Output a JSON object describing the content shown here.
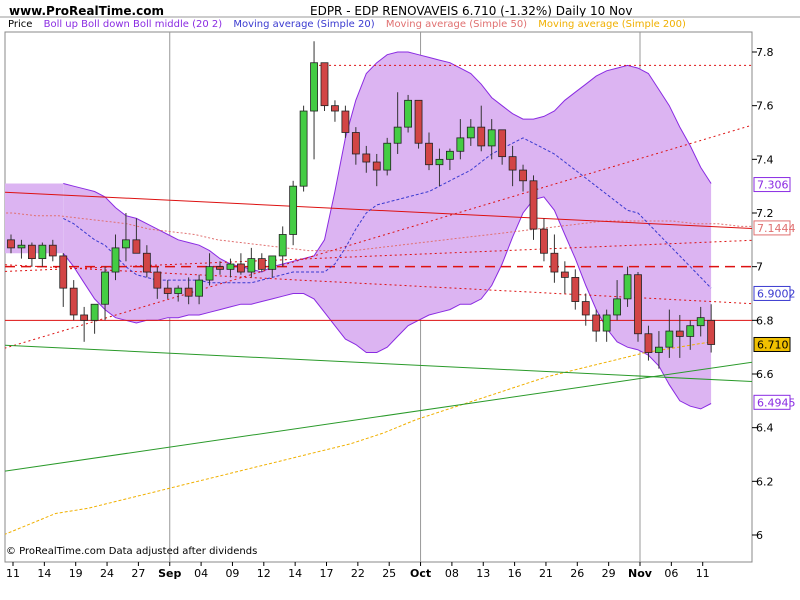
{
  "header": {
    "site": "www.ProRealTime.com",
    "title": "EDPR - EDP RENOVAVEIS    6.710 (-1.32%)    Daily  10 Nov"
  },
  "legend": [
    {
      "label": "Price",
      "color": "#000000"
    },
    {
      "label": "Boll up Boll down Boll middle (20 2)",
      "color": "#8a2be2"
    },
    {
      "label": "Moving average (Simple 20)",
      "color": "#3a3ad0"
    },
    {
      "label": "Moving average (Simple 50)",
      "color": "#e07070"
    },
    {
      "label": "Moving average (Simple 200)",
      "color": "#f0b000"
    }
  ],
  "footer": "© ProRealTime.com  Data adjusted after dividends",
  "chart_data": {
    "type": "candlestick",
    "y_ticks": [
      6,
      6.2,
      6.4,
      6.6,
      6.8,
      7,
      7.2,
      7.4,
      7.6,
      7.8
    ],
    "ylim": [
      5.94,
      7.92
    ],
    "x_ticks": [
      {
        "label": "11",
        "i": 0
      },
      {
        "label": "14",
        "i": 3
      },
      {
        "label": "19",
        "i": 6
      },
      {
        "label": "24",
        "i": 9
      },
      {
        "label": "27",
        "i": 12
      },
      {
        "label": "Sep",
        "i": 15,
        "month": true
      },
      {
        "label": "04",
        "i": 18
      },
      {
        "label": "09",
        "i": 21
      },
      {
        "label": "12",
        "i": 24
      },
      {
        "label": "14",
        "i": 27
      },
      {
        "label": "17",
        "i": 30
      },
      {
        "label": "22",
        "i": 33
      },
      {
        "label": "25",
        "i": 36
      },
      {
        "label": "Oct",
        "i": 39,
        "month": true
      },
      {
        "label": "08",
        "i": 42
      },
      {
        "label": "13",
        "i": 45
      },
      {
        "label": "16",
        "i": 48
      },
      {
        "label": "21",
        "i": 51
      },
      {
        "label": "26",
        "i": 54
      },
      {
        "label": "29",
        "i": 57
      },
      {
        "label": "Nov",
        "i": 60,
        "month": true
      },
      {
        "label": "06",
        "i": 63
      },
      {
        "label": "11",
        "i": 66
      }
    ],
    "candles": [
      [
        7.1,
        7.12,
        7.05,
        7.07
      ],
      [
        7.07,
        7.1,
        7.03,
        7.08
      ],
      [
        7.08,
        7.09,
        7.0,
        7.03
      ],
      [
        7.03,
        7.09,
        7.0,
        7.08
      ],
      [
        7.08,
        7.1,
        7.02,
        7.04
      ],
      [
        7.04,
        7.05,
        6.85,
        6.92
      ],
      [
        6.92,
        6.95,
        6.8,
        6.82
      ],
      [
        6.82,
        6.85,
        6.72,
        6.8
      ],
      [
        6.8,
        6.85,
        6.75,
        6.86
      ],
      [
        6.86,
        7.0,
        6.8,
        6.98
      ],
      [
        6.98,
        7.12,
        6.95,
        7.07
      ],
      [
        7.07,
        7.2,
        7.02,
        7.1
      ],
      [
        7.1,
        7.18,
        7.05,
        7.05
      ],
      [
        7.05,
        7.08,
        6.96,
        6.98
      ],
      [
        6.98,
        7.0,
        6.88,
        6.92
      ],
      [
        6.92,
        6.95,
        6.88,
        6.9
      ],
      [
        6.9,
        6.93,
        6.87,
        6.92
      ],
      [
        6.92,
        6.96,
        6.86,
        6.89
      ],
      [
        6.89,
        6.97,
        6.86,
        6.95
      ],
      [
        6.95,
        7.05,
        6.93,
        7.0
      ],
      [
        7.0,
        7.02,
        6.97,
        6.99
      ],
      [
        6.99,
        7.03,
        6.96,
        7.01
      ],
      [
        7.01,
        7.05,
        6.97,
        6.98
      ],
      [
        6.98,
        7.07,
        6.96,
        7.03
      ],
      [
        7.03,
        7.05,
        6.98,
        6.99
      ],
      [
        6.99,
        7.04,
        6.96,
        7.04
      ],
      [
        7.04,
        7.15,
        7.0,
        7.12
      ],
      [
        7.12,
        7.32,
        7.08,
        7.3
      ],
      [
        7.3,
        7.6,
        7.28,
        7.58
      ],
      [
        7.58,
        7.84,
        7.4,
        7.76
      ],
      [
        7.76,
        7.65,
        7.58,
        7.6
      ],
      [
        7.6,
        7.62,
        7.54,
        7.58
      ],
      [
        7.58,
        7.6,
        7.48,
        7.5
      ],
      [
        7.5,
        7.52,
        7.38,
        7.42
      ],
      [
        7.42,
        7.45,
        7.35,
        7.39
      ],
      [
        7.39,
        7.42,
        7.3,
        7.36
      ],
      [
        7.36,
        7.48,
        7.34,
        7.46
      ],
      [
        7.46,
        7.65,
        7.42,
        7.52
      ],
      [
        7.52,
        7.64,
        7.5,
        7.62
      ],
      [
        7.62,
        7.6,
        7.44,
        7.46
      ],
      [
        7.46,
        7.5,
        7.36,
        7.38
      ],
      [
        7.38,
        7.44,
        7.3,
        7.4
      ],
      [
        7.4,
        7.44,
        7.36,
        7.43
      ],
      [
        7.43,
        7.55,
        7.4,
        7.48
      ],
      [
        7.48,
        7.55,
        7.45,
        7.52
      ],
      [
        7.52,
        7.6,
        7.43,
        7.45
      ],
      [
        7.45,
        7.55,
        7.4,
        7.51
      ],
      [
        7.51,
        7.48,
        7.38,
        7.41
      ],
      [
        7.41,
        7.45,
        7.3,
        7.36
      ],
      [
        7.36,
        7.38,
        7.28,
        7.32
      ],
      [
        7.32,
        7.34,
        7.1,
        7.14
      ],
      [
        7.14,
        7.18,
        7.02,
        7.05
      ],
      [
        7.05,
        7.12,
        6.94,
        6.98
      ],
      [
        6.98,
        7.02,
        6.9,
        6.96
      ],
      [
        6.96,
        6.99,
        6.84,
        6.87
      ],
      [
        6.87,
        6.9,
        6.78,
        6.82
      ],
      [
        6.82,
        6.84,
        6.72,
        6.76
      ],
      [
        6.76,
        6.84,
        6.72,
        6.82
      ],
      [
        6.82,
        6.95,
        6.8,
        6.88
      ],
      [
        6.88,
        7.0,
        6.85,
        6.97
      ],
      [
        6.97,
        6.98,
        6.72,
        6.75
      ],
      [
        6.75,
        6.78,
        6.65,
        6.68
      ],
      [
        6.68,
        6.76,
        6.62,
        6.7
      ],
      [
        6.7,
        6.84,
        6.66,
        6.76
      ],
      [
        6.76,
        6.82,
        6.66,
        6.74
      ],
      [
        6.74,
        6.8,
        6.69,
        6.78
      ],
      [
        6.78,
        6.85,
        6.74,
        6.81
      ],
      [
        6.8,
        6.86,
        6.68,
        6.71
      ]
    ],
    "boll_upper": [
      7.31,
      7.3,
      7.29,
      7.28,
      7.26,
      7.22,
      7.19,
      7.18,
      7.16,
      7.14,
      7.12,
      7.1,
      7.09,
      7.08,
      7.06,
      7.03,
      7.01,
      7.0,
      6.99,
      6.98,
      7.0,
      7.01,
      7.02,
      7.03,
      7.04,
      7.1,
      7.28,
      7.48,
      7.62,
      7.72,
      7.76,
      7.79,
      7.8,
      7.8,
      7.79,
      7.78,
      7.77,
      7.76,
      7.74,
      7.72,
      7.68,
      7.63,
      7.6,
      7.57,
      7.55,
      7.55,
      7.56,
      7.58,
      7.62,
      7.65,
      7.68,
      7.71,
      7.73,
      7.74,
      7.75,
      7.74,
      7.72,
      7.66,
      7.6,
      7.52,
      7.45,
      7.37,
      7.31
    ],
    "boll_lower": [
      7.05,
      7.0,
      6.94,
      6.88,
      6.84,
      6.81,
      6.8,
      6.79,
      6.8,
      6.8,
      6.81,
      6.81,
      6.82,
      6.82,
      6.83,
      6.84,
      6.85,
      6.86,
      6.86,
      6.87,
      6.88,
      6.89,
      6.9,
      6.9,
      6.88,
      6.83,
      6.78,
      6.73,
      6.71,
      6.68,
      6.68,
      6.7,
      6.74,
      6.78,
      6.8,
      6.82,
      6.83,
      6.84,
      6.86,
      6.86,
      6.88,
      6.93,
      7.01,
      7.11,
      7.2,
      7.25,
      7.26,
      7.21,
      7.12,
      7.03,
      6.93,
      6.84,
      6.77,
      6.72,
      6.7,
      6.69,
      6.67,
      6.63,
      6.56,
      6.5,
      6.48,
      6.47,
      6.49
    ],
    "ma20": [
      7.18,
      7.16,
      7.13,
      7.1,
      7.08,
      7.04,
      7.0,
      6.97,
      6.96,
      6.95,
      6.95,
      6.95,
      6.95,
      6.95,
      6.94,
      6.94,
      6.94,
      6.94,
      6.94,
      6.95,
      6.96,
      6.97,
      6.98,
      6.98,
      6.98,
      6.98,
      7.01,
      7.07,
      7.14,
      7.2,
      7.23,
      7.24,
      7.25,
      7.26,
      7.27,
      7.28,
      7.3,
      7.32,
      7.34,
      7.36,
      7.39,
      7.42,
      7.44,
      7.46,
      7.48,
      7.46,
      7.44,
      7.42,
      7.39,
      7.36,
      7.33,
      7.3,
      7.27,
      7.24,
      7.21,
      7.2,
      7.16,
      7.12,
      7.08,
      7.04,
      7.0,
      6.96,
      6.92
    ],
    "ma50": [
      7.2,
      7.2,
      7.19,
      7.19,
      7.18,
      7.17,
      7.16,
      7.14,
      7.13,
      7.12,
      7.1,
      7.09,
      7.08,
      7.07,
      7.06,
      7.06,
      7.06,
      7.07,
      7.08,
      7.09,
      7.1,
      7.11,
      7.12,
      7.13,
      7.14,
      7.15,
      7.16,
      7.17,
      7.17,
      7.17,
      7.17,
      7.16,
      7.16,
      7.15,
      7.15
    ],
    "ma200": [
      5.98,
      6.03,
      6.08,
      6.1,
      6.13,
      6.16,
      6.19,
      6.22,
      6.25,
      6.28,
      6.31,
      6.34,
      6.38,
      6.43,
      6.47,
      6.51,
      6.55,
      6.59,
      6.62,
      6.65,
      6.68,
      6.7,
      6.72
    ],
    "reference_lines": [
      {
        "kind": "horizontal",
        "value": 7.75,
        "start_i": 29,
        "end_i": 71,
        "color": "#dd1111",
        "dash": "dotted"
      },
      {
        "kind": "horizontal",
        "value": 7.0,
        "start_i": -2,
        "end_i": 72,
        "color": "#dd1111",
        "dash": "dashed"
      },
      {
        "kind": "horizontal",
        "value": 6.8,
        "start_i": -2,
        "end_i": 72,
        "color": "#dd1111",
        "dash": "solid"
      },
      {
        "kind": "trend",
        "from": [
          -2,
          6.68
        ],
        "to": [
          72,
          7.54
        ],
        "color": "#dd1111",
        "dash": "dotted"
      },
      {
        "kind": "trend",
        "from": [
          -2,
          6.98
        ],
        "to": [
          72,
          7.1
        ],
        "color": "#dd1111",
        "dash": "dotted"
      },
      {
        "kind": "trend",
        "from": [
          -2,
          7.01
        ],
        "to": [
          72,
          6.86
        ],
        "color": "#dd1111",
        "dash": "dotted"
      },
      {
        "kind": "trend",
        "from": [
          -2,
          7.28
        ],
        "to": [
          72,
          7.14
        ],
        "color": "#dd1111",
        "dash": "solid"
      },
      {
        "kind": "trend",
        "from": [
          -2,
          6.23
        ],
        "to": [
          72,
          6.65
        ],
        "color": "#2a9a2a",
        "dash": "solid"
      },
      {
        "kind": "trend",
        "from": [
          -2,
          6.71
        ],
        "to": [
          72,
          6.57
        ],
        "color": "#2a9a2a",
        "dash": "solid"
      }
    ],
    "price_labels": [
      {
        "value": 7.306,
        "text": "7.306",
        "border": "#8a2be2",
        "bg": "#ffffff",
        "fg": "#8a2be2"
      },
      {
        "value": 7.1444,
        "text": "7.1444",
        "border": "#e07070",
        "bg": "#ffffff",
        "fg": "#e07070"
      },
      {
        "value": 6.9002,
        "text": "6.9002",
        "border": "#3a3ad0",
        "bg": "#ffffff",
        "fg": "#3a3ad0"
      },
      {
        "value": 6.71,
        "text": "6.710",
        "border": "#000000",
        "bg": "#f0c000",
        "fg": "#000000"
      },
      {
        "value": 6.4945,
        "text": "6.4945",
        "border": "#8a2be2",
        "bg": "#ffffff",
        "fg": "#8a2be2"
      }
    ],
    "colors": {
      "up": "#44cc44",
      "down": "#d24545",
      "band_fill": "#dcb4f2",
      "band_line": "#8a2be2",
      "ma20": "#3a3ad0",
      "ma50": "#e07070",
      "ma200": "#f0b000",
      "grid": "#bbbbbb"
    }
  }
}
